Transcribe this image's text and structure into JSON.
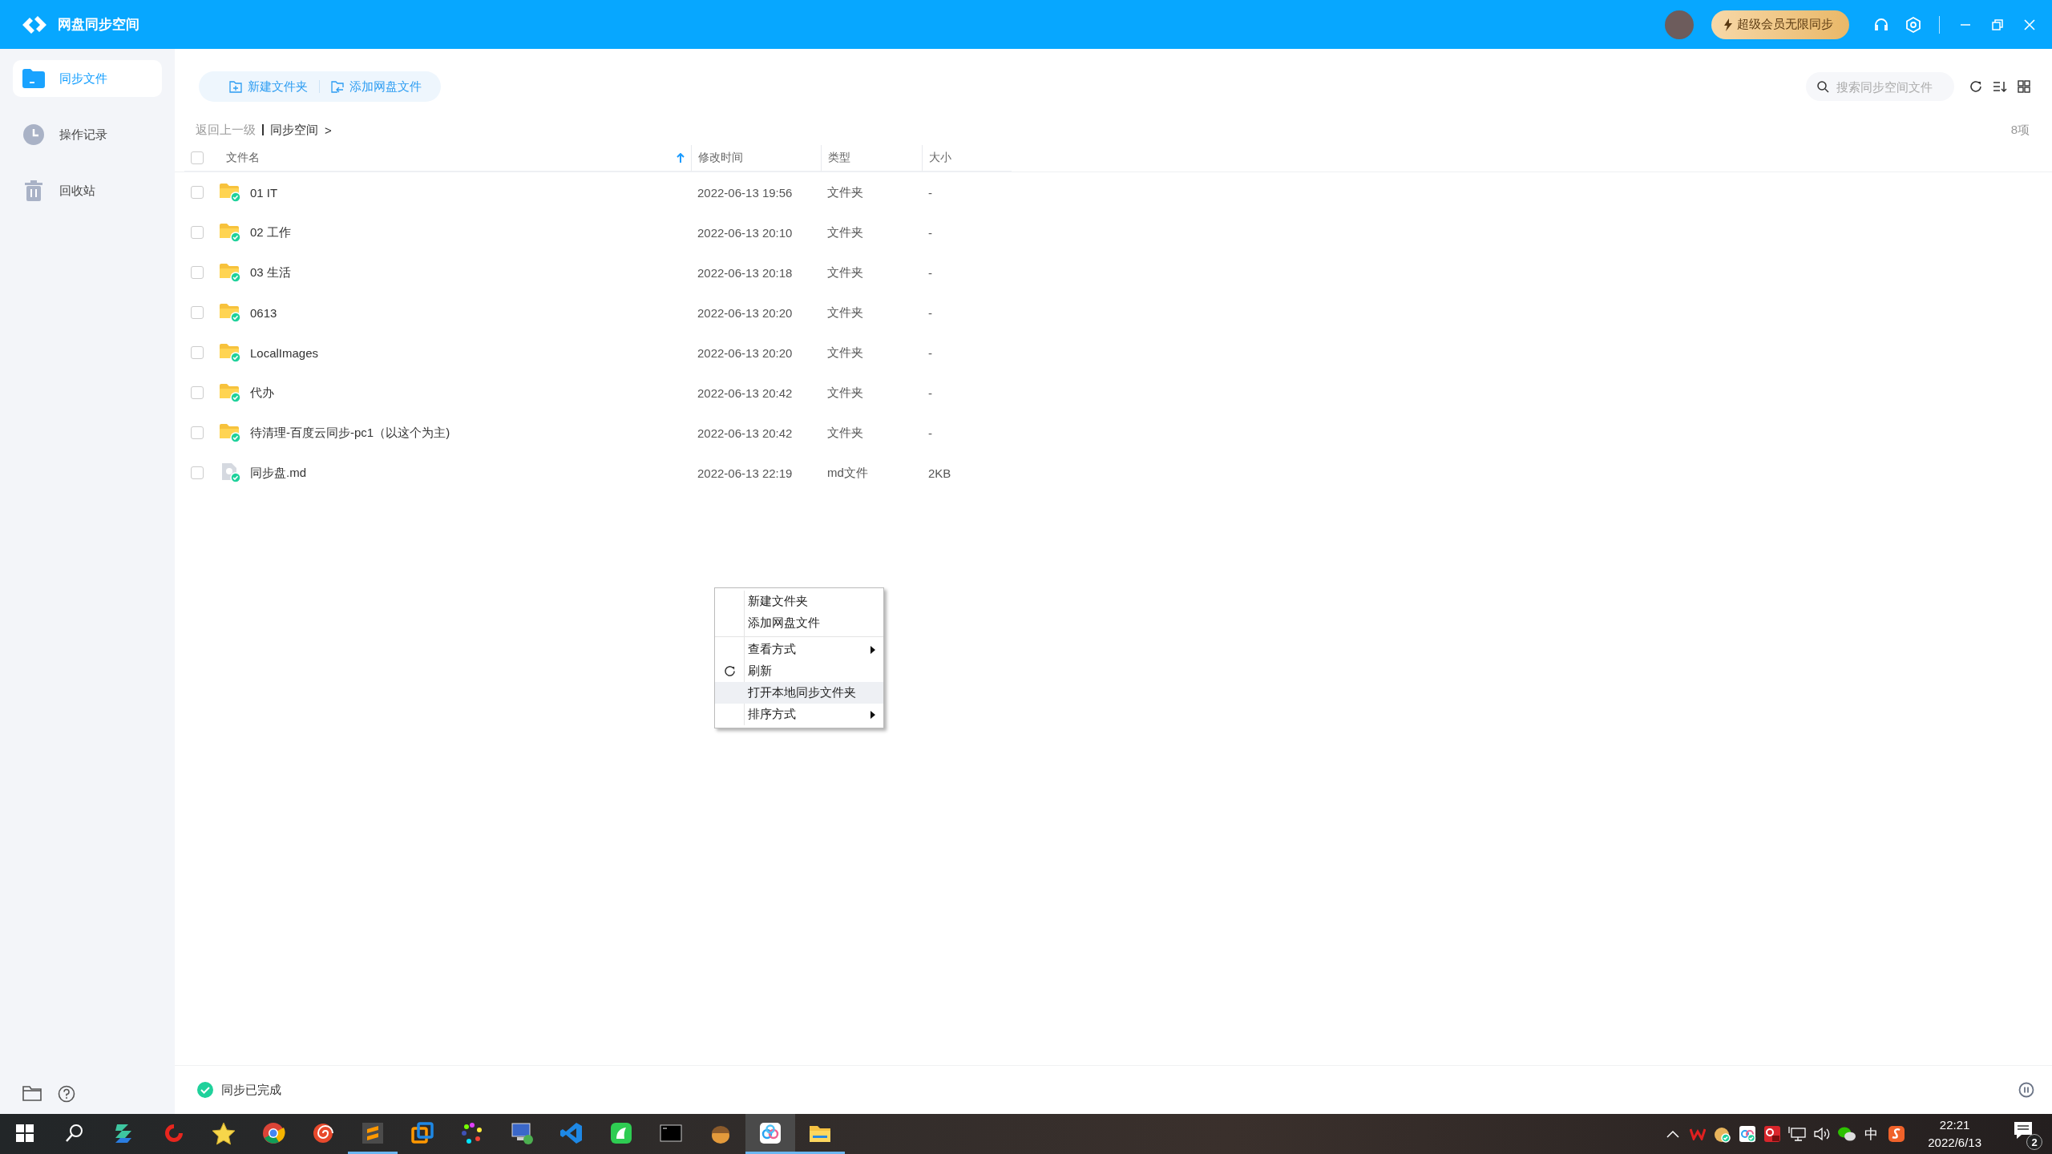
{
  "window": {
    "title": "网盘同步空间",
    "vip_button": "超级会员无限同步"
  },
  "sidebar": {
    "items": [
      {
        "label": "同步文件",
        "selected": true,
        "kind": "files"
      },
      {
        "label": "操作记录",
        "selected": false,
        "kind": "history"
      },
      {
        "label": "回收站",
        "selected": false,
        "kind": "trash"
      }
    ]
  },
  "toolbar": {
    "buttons": [
      "新建文件夹",
      "添加网盘文件"
    ],
    "search": {
      "placeholder": "搜索同步空间文件"
    }
  },
  "breadcrumb": {
    "back": "返回上一级",
    "path": "同步空间",
    "separator": ">"
  },
  "item_count": "8项",
  "table": {
    "all_checked": false,
    "columns": [
      {
        "label": "文件名",
        "sorted": true
      },
      {
        "label": "修改时间",
        "sorted": false
      },
      {
        "label": "类型",
        "sorted": false
      },
      {
        "label": "大小",
        "sorted": false
      }
    ],
    "rows": [
      {
        "kind": "folder",
        "checked": false,
        "synced": true,
        "name": "01 IT",
        "modified": "2022-06-13 19:56",
        "type": "文件夹",
        "size": "-"
      },
      {
        "kind": "folder",
        "checked": false,
        "synced": true,
        "name": "02 工作",
        "modified": "2022-06-13 20:10",
        "type": "文件夹",
        "size": "-"
      },
      {
        "kind": "folder",
        "checked": false,
        "synced": true,
        "name": "03 生活",
        "modified": "2022-06-13 20:18",
        "type": "文件夹",
        "size": "-"
      },
      {
        "kind": "folder",
        "checked": false,
        "synced": true,
        "name": "0613",
        "modified": "2022-06-13 20:20",
        "type": "文件夹",
        "size": "-"
      },
      {
        "kind": "folder",
        "checked": false,
        "synced": true,
        "name": "LocalImages",
        "modified": "2022-06-13 20:20",
        "type": "文件夹",
        "size": "-"
      },
      {
        "kind": "folder",
        "checked": false,
        "synced": true,
        "name": "代办",
        "modified": "2022-06-13 20:42",
        "type": "文件夹",
        "size": "-"
      },
      {
        "kind": "folder",
        "checked": false,
        "synced": true,
        "name": "待清理-百度云同步-pc1（以这个为主)",
        "modified": "2022-06-13 20:42",
        "type": "文件夹",
        "size": "-"
      },
      {
        "kind": "file",
        "checked": false,
        "synced": true,
        "name": "同步盘.md",
        "modified": "2022-06-13 22:19",
        "type": "md文件",
        "size": "2KB"
      }
    ]
  },
  "context_menu": {
    "items": [
      {
        "label": "新建文件夹",
        "kind": "plain",
        "submenu": false,
        "highlighted": false,
        "separator_before": false
      },
      {
        "label": "添加网盘文件",
        "kind": "plain",
        "submenu": false,
        "highlighted": false,
        "separator_before": false
      },
      {
        "label": "查看方式",
        "kind": "plain",
        "submenu": true,
        "highlighted": false,
        "separator_before": true
      },
      {
        "label": "刷新",
        "kind": "refresh",
        "submenu": false,
        "highlighted": false,
        "separator_before": false
      },
      {
        "label": "打开本地同步文件夹",
        "kind": "plain",
        "submenu": false,
        "highlighted": true,
        "separator_before": false
      },
      {
        "label": "排序方式",
        "kind": "plain",
        "submenu": true,
        "highlighted": false,
        "separator_before": false
      }
    ]
  },
  "status_bar": {
    "text": "同步已完成"
  },
  "taskbar": {
    "apps": [
      {
        "kind": "start",
        "running": false,
        "selected": false
      },
      {
        "kind": "search",
        "running": false,
        "selected": false
      },
      {
        "kind": "chevrons",
        "running": false,
        "selected": false
      },
      {
        "kind": "swirl",
        "running": false,
        "selected": false
      },
      {
        "kind": "star",
        "running": false,
        "selected": false
      },
      {
        "kind": "round",
        "running": false,
        "selected": false
      },
      {
        "kind": "spiral",
        "running": false,
        "selected": false
      },
      {
        "kind": "bars",
        "running": true,
        "selected": false
      },
      {
        "kind": "squares",
        "running": false,
        "selected": false
      },
      {
        "kind": "dots",
        "running": false,
        "selected": false
      },
      {
        "kind": "monitor",
        "running": false,
        "selected": false
      },
      {
        "kind": "ribbon",
        "running": false,
        "selected": false
      },
      {
        "kind": "greentile",
        "running": false,
        "selected": false
      },
      {
        "kind": "terminal",
        "running": false,
        "selected": false
      },
      {
        "kind": "acorn",
        "running": false,
        "selected": false
      },
      {
        "kind": "cloud",
        "running": true,
        "selected": true
      },
      {
        "kind": "folder",
        "running": true,
        "selected": false
      }
    ],
    "ime": "中",
    "time": "22:21",
    "date": "2022/6/13",
    "notifications": "2"
  }
}
